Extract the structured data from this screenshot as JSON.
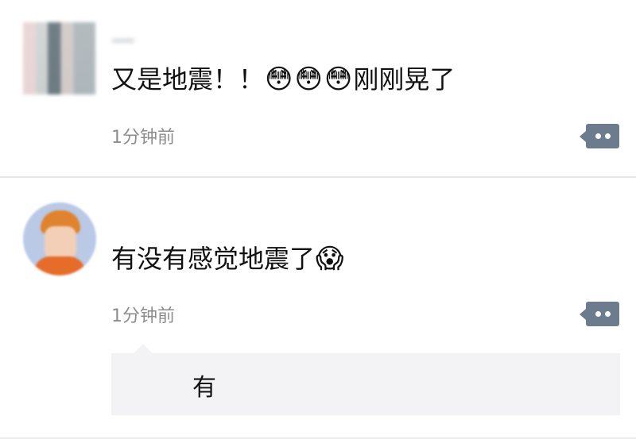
{
  "comments": [
    {
      "username": "一",
      "message_text": "又是地震！！",
      "emojis": [
        "😳",
        "😳",
        "😳"
      ],
      "message_tail": "刚刚晃了",
      "timestamp": "1分钟前",
      "action_icon": "comment-more-icon"
    },
    {
      "username": "",
      "message_text": "有没有感觉地震了",
      "emojis": [
        "😱"
      ],
      "message_tail": "",
      "timestamp": "1分钟前",
      "action_icon": "comment-more-icon",
      "reply": {
        "username": "",
        "text": "有"
      }
    }
  ],
  "colors": {
    "timestamp": "#8c8c8c",
    "action_button": "#6d7b8f",
    "reply_background": "#f3f3f5",
    "divider": "#e7e7e7"
  }
}
